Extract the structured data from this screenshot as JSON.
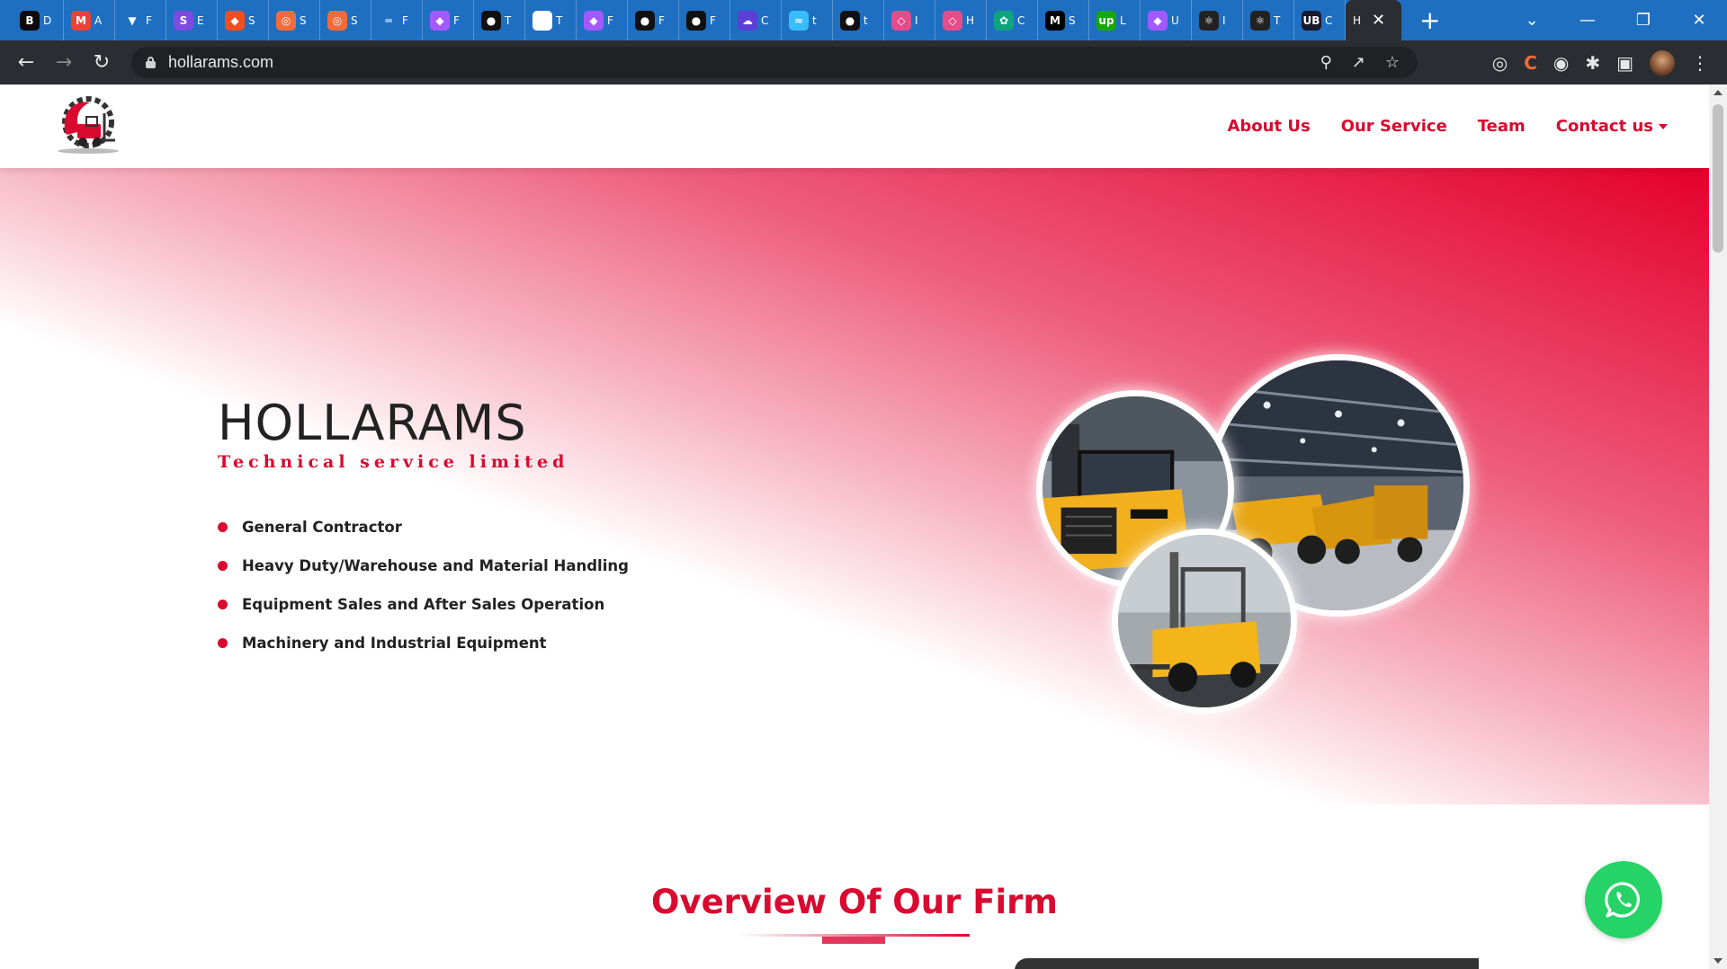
{
  "browser": {
    "tabs": [
      {
        "letter": "D",
        "icon": "B",
        "color": "#0b0b0b"
      },
      {
        "letter": "A",
        "icon": "M",
        "color": "#ea4335"
      },
      {
        "letter": "F",
        "icon": "▼",
        "color": "#1e6fc2"
      },
      {
        "letter": "E",
        "icon": "S",
        "color": "#7b4ce0"
      },
      {
        "letter": "S",
        "icon": "◆",
        "color": "#f24e1e"
      },
      {
        "letter": "S",
        "icon": "◎",
        "color": "#f26b3a"
      },
      {
        "letter": "S",
        "icon": "◎",
        "color": "#f26b3a"
      },
      {
        "letter": "F",
        "icon": "═",
        "color": "#1e6fc2"
      },
      {
        "letter": "F",
        "icon": "◆",
        "color": "#a259ff"
      },
      {
        "letter": "T",
        "icon": "●",
        "color": "#111111"
      },
      {
        "letter": "T",
        "icon": "◉",
        "color": "#ffffff"
      },
      {
        "letter": "F",
        "icon": "◆",
        "color": "#a259ff"
      },
      {
        "letter": "F",
        "icon": "●",
        "color": "#111111"
      },
      {
        "letter": "F",
        "icon": "●",
        "color": "#111111"
      },
      {
        "letter": "C",
        "icon": "☁",
        "color": "#5b3fd6"
      },
      {
        "letter": "t",
        "icon": "≈",
        "color": "#38bdf8"
      },
      {
        "letter": "t",
        "icon": "●",
        "color": "#111111"
      },
      {
        "letter": "I",
        "icon": "◇",
        "color": "#e44d8a"
      },
      {
        "letter": "H",
        "icon": "◇",
        "color": "#e44d8a"
      },
      {
        "letter": "C",
        "icon": "✿",
        "color": "#10a37f"
      },
      {
        "letter": "S",
        "icon": "M",
        "color": "#000000"
      },
      {
        "letter": "L",
        "icon": "up",
        "color": "#14a800"
      },
      {
        "letter": "U",
        "icon": "◆",
        "color": "#a259ff"
      },
      {
        "letter": "I",
        "icon": "⚛",
        "color": "#222222"
      },
      {
        "letter": "T",
        "icon": "⚛",
        "color": "#222222"
      },
      {
        "letter": "C",
        "icon": "UB",
        "color": "#1a1a2e"
      }
    ],
    "active_tab": {
      "letter": "H"
    },
    "url": "hollarams.com"
  },
  "nav": {
    "links": [
      "About Us",
      "Our Service",
      "Team"
    ],
    "contact": "Contact us"
  },
  "hero": {
    "title": "HOLLARAMS",
    "subtitle": "Technical service limited",
    "bullets": [
      "General Contractor",
      "Heavy Duty/Warehouse and Material Handling",
      "Equipment Sales and After Sales Operation",
      "Machinery and Industrial Equipment"
    ]
  },
  "overview": {
    "heading": "Overview Of Our Firm"
  },
  "colors": {
    "brand": "#d9092f",
    "whatsapp": "#25d366",
    "chrome_tabstrip": "#1e6fc2"
  },
  "icons": {
    "whatsapp": "whatsapp-icon",
    "logo": "forklift-gear-logo"
  }
}
